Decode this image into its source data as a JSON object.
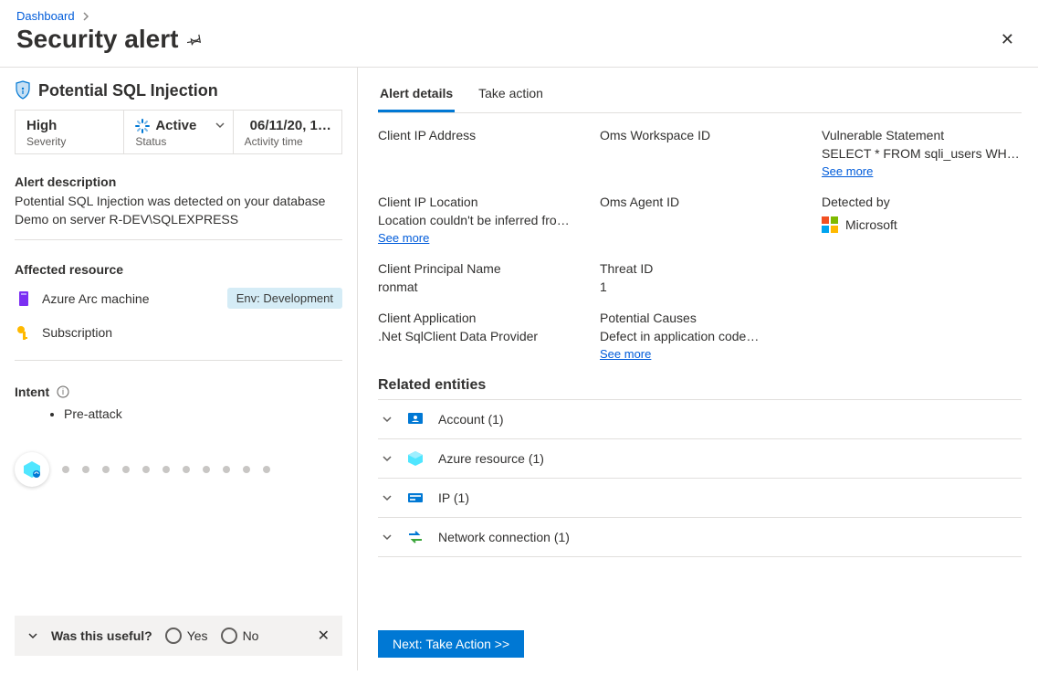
{
  "breadcrumb": {
    "dashboard": "Dashboard"
  },
  "page_title": "Security alert",
  "alert": {
    "name": "Potential SQL Injection",
    "severity_value": "High",
    "severity_label": "Severity",
    "status_value": "Active",
    "status_label": "Status",
    "activity_value": "06/11/20, 1…",
    "activity_label": "Activity time"
  },
  "description": {
    "title": "Alert description",
    "body": "Potential SQL Injection was detected on your database Demo on server R-DEV\\SQLEXPRESS"
  },
  "affected": {
    "title": "Affected resource",
    "rows": [
      {
        "label": "Azure Arc machine",
        "chip": "Env: Development"
      },
      {
        "label": "Subscription"
      }
    ]
  },
  "intent": {
    "title": "Intent",
    "items": [
      "Pre-attack"
    ]
  },
  "feedback": {
    "question": "Was this useful?",
    "yes": "Yes",
    "no": "No"
  },
  "tabs": {
    "details": "Alert details",
    "take_action": "Take action"
  },
  "details": {
    "col1": {
      "a": {
        "label": "Client IP Address"
      },
      "b": {
        "label": "Client IP Location",
        "value": "Location couldn't be inferred from…",
        "more": "See more"
      },
      "c": {
        "label": "Client Principal Name",
        "value": "ronmat"
      },
      "d": {
        "label": "Client Application",
        "value": ".Net SqlClient Data Provider"
      }
    },
    "col2": {
      "a": {
        "label": "Oms Workspace ID"
      },
      "b": {
        "label": "Oms Agent ID"
      },
      "c": {
        "label": "Threat ID",
        "value": "1"
      },
      "d": {
        "label": "Potential Causes",
        "value": "Defect in application code…",
        "more": "See more"
      }
    },
    "col3": {
      "a": {
        "label": "Vulnerable Statement",
        "value": "SELECT * FROM sqli_users WHERE…",
        "more": "See more"
      },
      "b": {
        "label": "Detected by",
        "value": "Microsoft"
      }
    }
  },
  "related": {
    "title": "Related entities",
    "rows": [
      {
        "label": "Account (1)"
      },
      {
        "label": "Azure resource (1)"
      },
      {
        "label": "IP (1)"
      },
      {
        "label": "Network connection (1)"
      }
    ]
  },
  "cta": {
    "label": "Next: Take Action  >>"
  }
}
